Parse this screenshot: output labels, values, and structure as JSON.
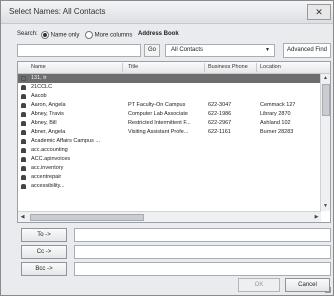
{
  "window": {
    "title": "Select Names: All Contacts",
    "close_glyph": "✕"
  },
  "search": {
    "label": "Search:",
    "option_name_only": "Name only",
    "option_more_columns": "More columns",
    "address_book_label": "Address Book",
    "selected_option": "Name only",
    "input_value": "",
    "go_label": "Go",
    "address_book_value": "All Contacts",
    "advanced_find_label": "Advanced Find"
  },
  "columns": {
    "name": "Name",
    "title": "Title",
    "phone": "Business Phone",
    "location": "Location"
  },
  "rows": [
    {
      "icon": "group-icon",
      "name": "131, tr",
      "title": "",
      "phone": "",
      "location": "",
      "selected": true
    },
    {
      "icon": "user-icon",
      "name": "21CCLC",
      "title": "",
      "phone": "",
      "location": ""
    },
    {
      "icon": "user-icon",
      "name": "Aacob",
      "title": "",
      "phone": "",
      "location": ""
    },
    {
      "icon": "user-icon",
      "name": "Aaron, Angela",
      "title": "PT Faculty-On Campus",
      "phone": "622-3047",
      "location": "Cemmack 127"
    },
    {
      "icon": "user-icon",
      "name": "Abney, Travis",
      "title": "Computer Lab Associate",
      "phone": "622-1986",
      "location": "Library 2870"
    },
    {
      "icon": "user-icon",
      "name": "Abney, Bill",
      "title": "Restricted Intermittent F...",
      "phone": "622-2967",
      "location": "Ashland 102"
    },
    {
      "icon": "user-icon",
      "name": "Abner, Angela",
      "title": "Visiting Assistant Profe...",
      "phone": "622-1161",
      "location": "Burner 28283"
    },
    {
      "icon": "user-icon",
      "name": "Academic Affairs Campus ...",
      "title": "",
      "phone": "",
      "location": ""
    },
    {
      "icon": "user-icon",
      "name": "acc.accounting",
      "title": "",
      "phone": "",
      "location": ""
    },
    {
      "icon": "user-icon",
      "name": "ACC.apinvoices",
      "title": "",
      "phone": "",
      "location": ""
    },
    {
      "icon": "user-icon",
      "name": "acc.inventory",
      "title": "",
      "phone": "",
      "location": ""
    },
    {
      "icon": "user-icon",
      "name": "accentrepair",
      "title": "",
      "phone": "",
      "location": ""
    },
    {
      "icon": "user-icon",
      "name": "accessibility...",
      "title": "",
      "phone": "",
      "location": ""
    }
  ],
  "recipients": {
    "to_label": "To ->",
    "cc_label": "Cc ->",
    "bcc_label": "Bcc ->",
    "to_value": "",
    "cc_value": "",
    "bcc_value": ""
  },
  "footer": {
    "ok_label": "OK",
    "cancel_label": "Cancel"
  }
}
